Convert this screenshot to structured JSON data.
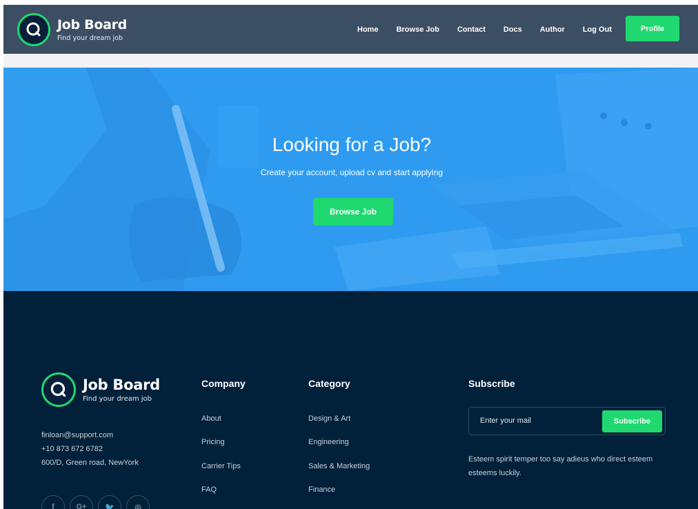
{
  "brand": {
    "title": "Job Board",
    "tagline": "Find your dream job",
    "icon": "magnifier-icon",
    "accent": "#1fd86f"
  },
  "nav": {
    "items": [
      "Home",
      "Browse Job",
      "Contact",
      "Docs",
      "Author",
      "Log Out"
    ],
    "profile_label": "Profile"
  },
  "hero": {
    "title": "Looking for a Job?",
    "subtitle": "Create your account, upload cv and start applying",
    "button_label": "Browse Job"
  },
  "footer": {
    "contact": {
      "email": "finloan@support.com",
      "phone": "+10 873 672 6782",
      "address": "600/D, Green road, NewYork"
    },
    "company": {
      "heading": "Company",
      "links": [
        "About",
        "Pricing",
        "Carrier Tips",
        "FAQ"
      ]
    },
    "category": {
      "heading": "Category",
      "links": [
        "Design & Art",
        "Engineering",
        "Sales & Marketing",
        "Finance"
      ]
    },
    "subscribe": {
      "heading": "Subscribe",
      "placeholder": "Enter your mail",
      "button_label": "Subscribe",
      "text": "Esteem spirit temper too say adieus who direct esteem esteems luckily."
    },
    "socials": [
      {
        "icon": "facebook-icon",
        "glyph": "f"
      },
      {
        "icon": "google-plus-icon",
        "glyph": "G+"
      },
      {
        "icon": "twitter-icon",
        "glyph": "🐦"
      },
      {
        "icon": "instagram-icon",
        "glyph": "◎"
      }
    ]
  },
  "colors": {
    "header_bg": "#3c4e63",
    "hero_bg": "#2f9bf0",
    "footer_bg": "#01203a"
  }
}
